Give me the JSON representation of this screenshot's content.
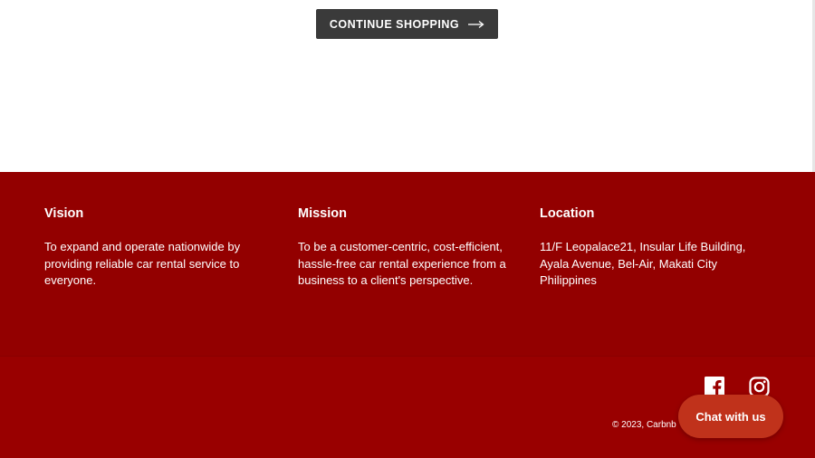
{
  "continue_button": {
    "label": "CONTINUE SHOPPING",
    "icon": "arrow-right-icon"
  },
  "footer": {
    "columns": [
      {
        "heading": "Vision",
        "text": "To expand and operate nationwide by providing reliable car rental service to everyone."
      },
      {
        "heading": "Mission",
        "text": "To be a customer-centric, cost-efficient, hassle-free car rental experience from a business to a client's perspective."
      },
      {
        "heading": "Location",
        "text": "11/F Leopalace21, Insular Life Building, Ayala Avenue, Bel-Air, Makati City Philippines"
      }
    ],
    "social": [
      {
        "name": "facebook-icon"
      },
      {
        "name": "instagram-icon"
      }
    ],
    "copyright": "© 2023, Carbnb"
  },
  "chat": {
    "label": "Chat with us"
  },
  "colors": {
    "footer_bg": "#930000",
    "footer_bottom_bg": "#990000",
    "button_dark": "#3a3a3a",
    "chat_bg": "#c0321b"
  }
}
